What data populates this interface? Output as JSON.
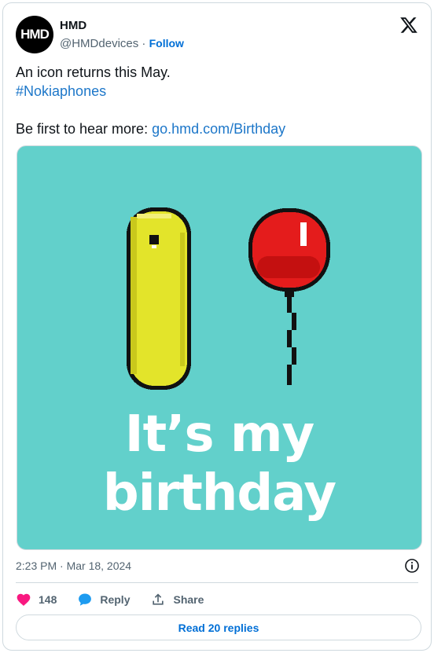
{
  "author": {
    "avatar_text": "HMD",
    "name": "HMD",
    "handle": "@HMDdevices",
    "separator": " · ",
    "follow_label": "Follow"
  },
  "tweet": {
    "line1": "An icon returns this May.",
    "hashtag": "#Nokiaphones",
    "line3_prefix": "Be first to hear more: ",
    "link": "go.hmd.com/Birthday"
  },
  "media": {
    "headline_line1": "It’s my",
    "headline_line2": "birthday",
    "background": "#62d0cb"
  },
  "meta": {
    "timestamp": "2:23 PM · Mar 18, 2024"
  },
  "actions": {
    "likes": "148",
    "reply_label": "Reply",
    "share_label": "Share"
  },
  "read_replies_label": "Read 20 replies",
  "colors": {
    "link": "#1d77c9",
    "like": "#f91880",
    "reply": "#1d9bf0"
  }
}
